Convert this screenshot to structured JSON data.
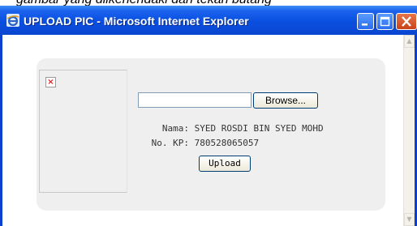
{
  "background_text": "gambar yang diikehendaki dan tekan butang",
  "window": {
    "title": "UPLOAD PIC - Microsoft Internet Explorer"
  },
  "form": {
    "file_input_value": "",
    "browse_label": "Browse...",
    "upload_label": "Upload"
  },
  "details": {
    "nama_label": "Nama:",
    "nama_value": "SYED ROSDI BIN SYED MOHD",
    "kp_label": "No. KP:",
    "kp_value": "780528065057"
  },
  "icons": {
    "window_icon": "internet-explorer-icon",
    "image_placeholder": "broken-image-icon"
  },
  "colors": {
    "titlebar": "#0a4fe0",
    "panel": "#efefef",
    "close": "#c9431a"
  }
}
